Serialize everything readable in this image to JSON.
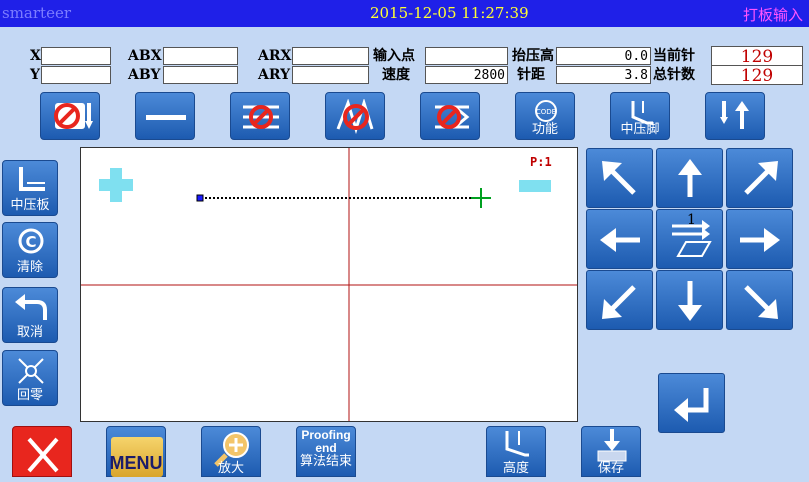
{
  "header": {
    "brand": "smarteer",
    "datetime": "2015-12-05 11:27:39",
    "mode": "打板输入"
  },
  "fields": {
    "x_label": "X",
    "x_value": "",
    "y_label": "Y",
    "y_value": "",
    "abx_label": "ABX",
    "abx_value": "",
    "aby_label": "ABY",
    "aby_value": "",
    "arx_label": "ARX",
    "arx_value": "",
    "ary_label": "ARY",
    "ary_value": "",
    "input_point_label": "输入点",
    "input_point_value": "",
    "speed_label": "速度",
    "speed_value": "2800",
    "lift_height_label": "抬压高",
    "lift_height_value": "0.0",
    "stitch_length_label": "针距",
    "stitch_length_value": "3.8",
    "current_needle_label": "当前针",
    "current_needle_value": "129",
    "total_needles_label": "总针数",
    "total_needles_value": "129"
  },
  "toolbar": {
    "items": [
      {
        "icon": "no-needle-icon",
        "label": ""
      },
      {
        "icon": "line-icon",
        "label": ""
      },
      {
        "icon": "no-stitch-icon",
        "label": ""
      },
      {
        "icon": "no-zigzag-icon",
        "label": ""
      },
      {
        "icon": "no-step-icon",
        "label": ""
      },
      {
        "icon": "code-icon",
        "label": "功能"
      },
      {
        "icon": "presser-foot-icon",
        "label": "中压脚"
      },
      {
        "icon": "needle-up-icon",
        "label": ""
      }
    ]
  },
  "left": {
    "items": [
      {
        "icon": "presser-plate-icon",
        "label": "中压板"
      },
      {
        "icon": "clear-icon",
        "label": "清除"
      },
      {
        "icon": "undo-icon",
        "label": "取消"
      },
      {
        "icon": "home-icon",
        "label": "回零"
      }
    ]
  },
  "canvas": {
    "page_label": "P:1"
  },
  "direction": {
    "center_label": "1"
  },
  "bottom": {
    "items": [
      {
        "icon": "close-icon",
        "label": ""
      },
      {
        "icon": "menu-icon",
        "label": "MENU"
      },
      {
        "icon": "zoom-in-icon",
        "label": "放大"
      },
      {
        "icon": "proofing-end-icon",
        "label_line1": "Proofing",
        "label_line2": "end",
        "label_line3": "算法结束"
      },
      {
        "icon": "height-icon",
        "label": "高度"
      },
      {
        "icon": "save-icon",
        "label": "保存"
      }
    ]
  },
  "colors": {
    "titlebar": "#1f20e8",
    "button": "#2a6cc4",
    "background": "#c4d8f4",
    "accent_red": "#e8261e"
  }
}
